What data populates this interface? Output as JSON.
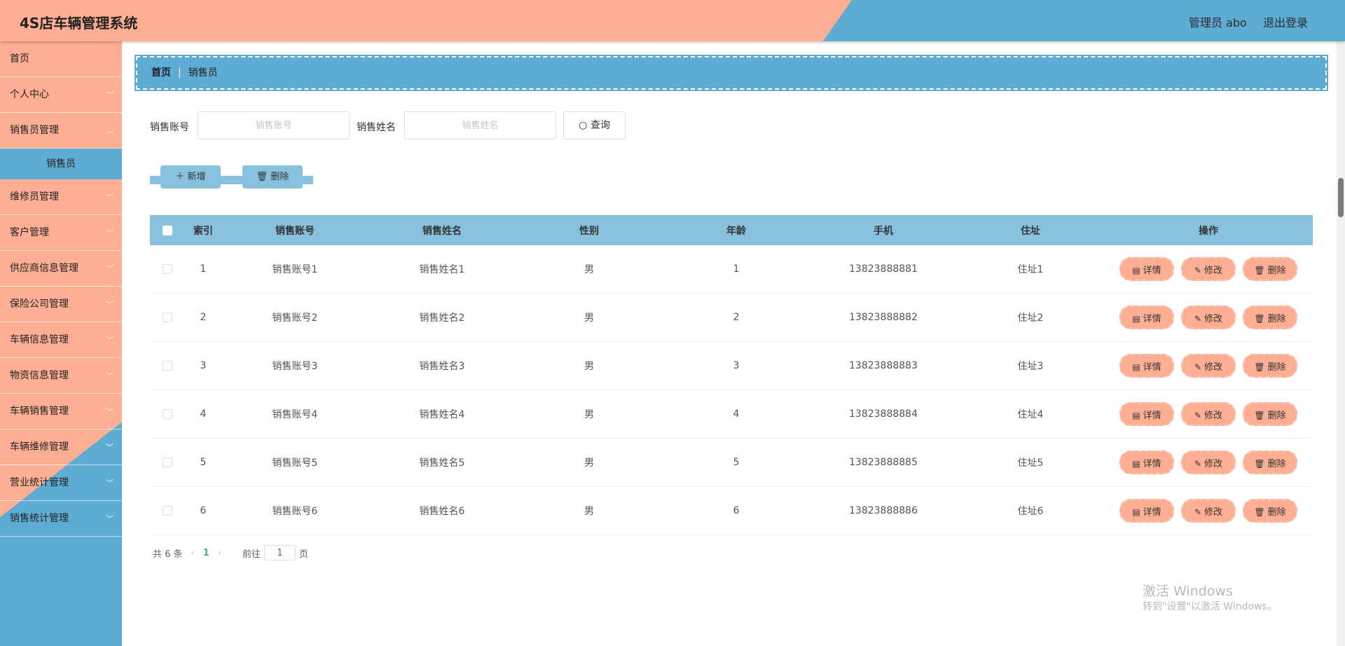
{
  "header": {
    "app_title": "4S店车辆管理系统",
    "user_label": "管理员 abo",
    "logout_label": "退出登录"
  },
  "sidebar": {
    "items": [
      {
        "label": "首页",
        "has_children": false
      },
      {
        "label": "个人中心",
        "has_children": true
      },
      {
        "label": "销售员管理",
        "has_children": true
      },
      {
        "label": "维修员管理",
        "has_children": true
      },
      {
        "label": "客户管理",
        "has_children": true
      },
      {
        "label": "供应商信息管理",
        "has_children": true
      },
      {
        "label": "保险公司管理",
        "has_children": true
      },
      {
        "label": "车辆信息管理",
        "has_children": true
      },
      {
        "label": "物资信息管理",
        "has_children": true
      },
      {
        "label": "车辆销售管理",
        "has_children": true
      },
      {
        "label": "车辆维修管理",
        "has_children": true
      },
      {
        "label": "营业统计管理",
        "has_children": true
      },
      {
        "label": "销售统计管理",
        "has_children": true
      }
    ],
    "active_submenu": "销售员"
  },
  "breadcrumb": {
    "home": "首页",
    "separator": "|",
    "current": "销售员"
  },
  "search": {
    "account_label": "销售账号",
    "account_placeholder": "销售账号",
    "name_label": "销售姓名",
    "name_placeholder": "销售姓名",
    "query_label": "查询"
  },
  "actions": {
    "add_label": "新增",
    "delete_label": "删除"
  },
  "table": {
    "headers": [
      "索引",
      "销售账号",
      "销售姓名",
      "性别",
      "年龄",
      "手机",
      "住址",
      "操作"
    ],
    "rows": [
      {
        "index": "1",
        "account": "销售账号1",
        "name": "销售姓名1",
        "gender": "男",
        "age": "1",
        "phone": "13823888881",
        "address": "住址1"
      },
      {
        "index": "2",
        "account": "销售账号2",
        "name": "销售姓名2",
        "gender": "男",
        "age": "2",
        "phone": "13823888882",
        "address": "住址2"
      },
      {
        "index": "3",
        "account": "销售账号3",
        "name": "销售姓名3",
        "gender": "男",
        "age": "3",
        "phone": "13823888883",
        "address": "住址3"
      },
      {
        "index": "4",
        "account": "销售账号4",
        "name": "销售姓名4",
        "gender": "男",
        "age": "4",
        "phone": "13823888884",
        "address": "住址4"
      },
      {
        "index": "5",
        "account": "销售账号5",
        "name": "销售姓名5",
        "gender": "男",
        "age": "5",
        "phone": "13823888885",
        "address": "住址5"
      },
      {
        "index": "6",
        "account": "销售账号6",
        "name": "销售姓名6",
        "gender": "男",
        "age": "6",
        "phone": "13823888886",
        "address": "住址6"
      }
    ],
    "row_actions": {
      "detail": "详情",
      "edit": "修改",
      "delete": "删除"
    }
  },
  "pagination": {
    "total_label": "共 6 条",
    "current_page": "1",
    "goto_prefix": "前往",
    "goto_value": "1",
    "goto_suffix": "页"
  },
  "watermark": {
    "title": "激活 Windows",
    "subtitle": "转到\"设置\"以激活 Windows。"
  },
  "colors": {
    "accent_salmon": "#fdae93",
    "accent_blue": "#5eabd3",
    "table_header": "#88c1de"
  }
}
